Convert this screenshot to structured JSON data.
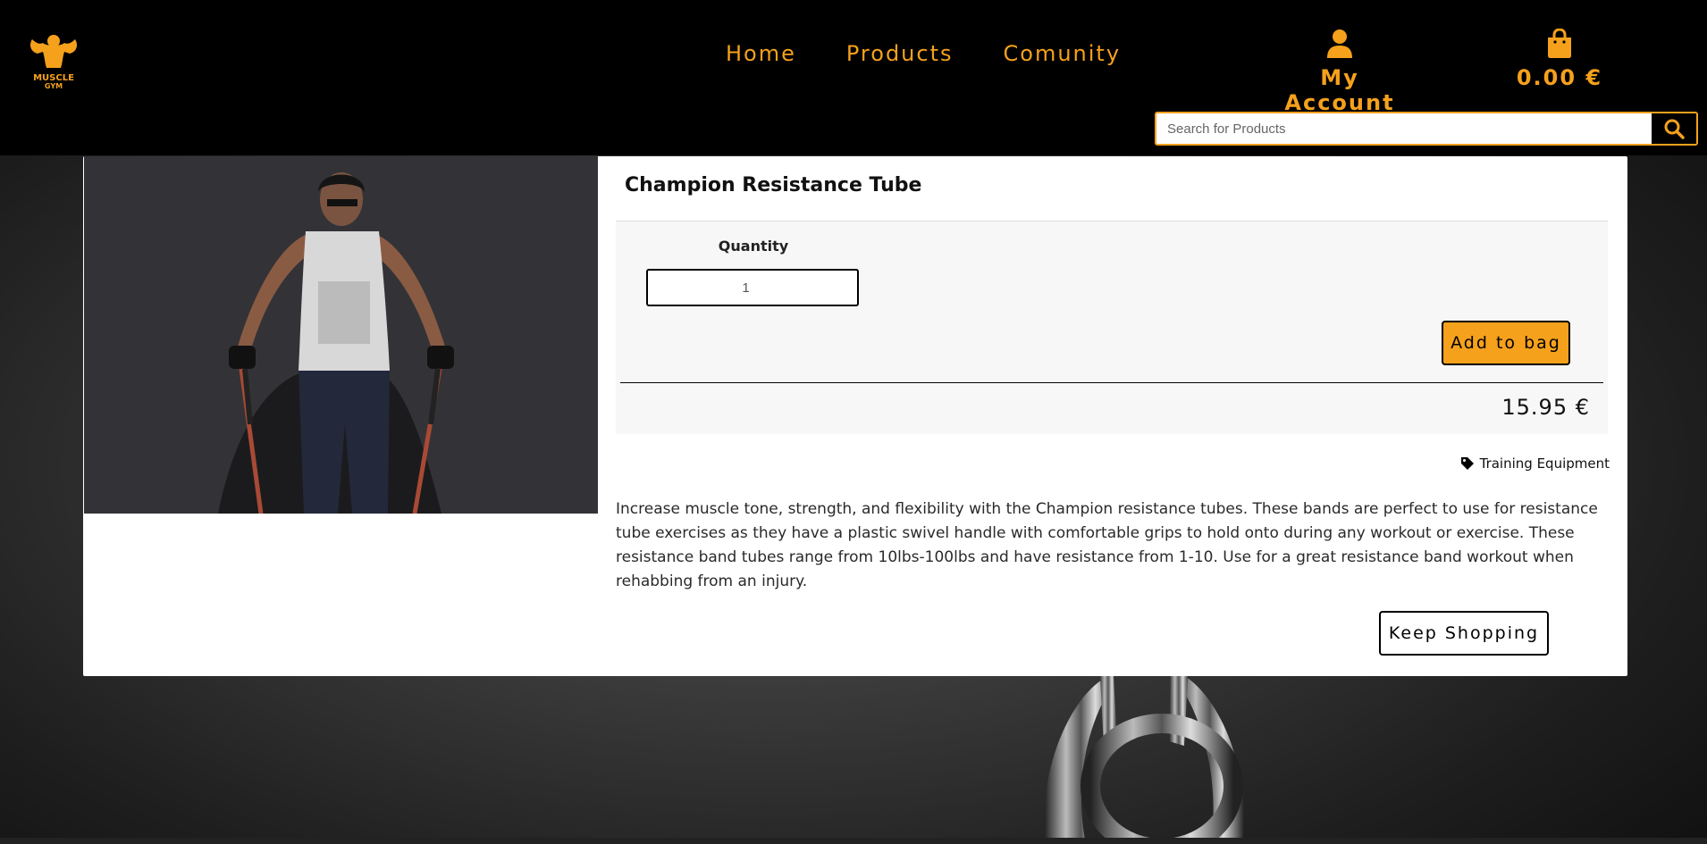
{
  "brand": {
    "logo_icon": "muscle-gym-logo",
    "line1": "MUSCLE",
    "line2": "GYM"
  },
  "nav": {
    "items": [
      {
        "label": "Home"
      },
      {
        "label": "Products"
      },
      {
        "label": "Comunity"
      }
    ]
  },
  "account": {
    "icon": "user-icon",
    "label": "My Account"
  },
  "bag": {
    "icon": "shopping-bag-icon",
    "total": "0.00 €"
  },
  "search": {
    "placeholder": "Search for Products",
    "value": "",
    "icon": "search-icon"
  },
  "product": {
    "title": "Champion Resistance Tube",
    "quantity_label": "Quantity",
    "quantity_value": "1",
    "add_button": "Add to bag",
    "price": "15.95 €",
    "category": "Training Equipment",
    "category_icon": "tag-icon",
    "description": "Increase muscle tone, strength, and flexibility with the Champion resistance tubes. These bands are perfect to use for resistance tube exercises as they have a plastic swivel handle with comfortable grips to hold onto during any workout or exercise. These resistance band tubes range from 10lbs-100lbs and have resistance from 1-10. Use for a great resistance band workout when rehabbing from an injury.",
    "keep_shopping": "Keep Shopping"
  },
  "colors": {
    "accent": "#f5a11c",
    "header_bg": "#000000"
  }
}
